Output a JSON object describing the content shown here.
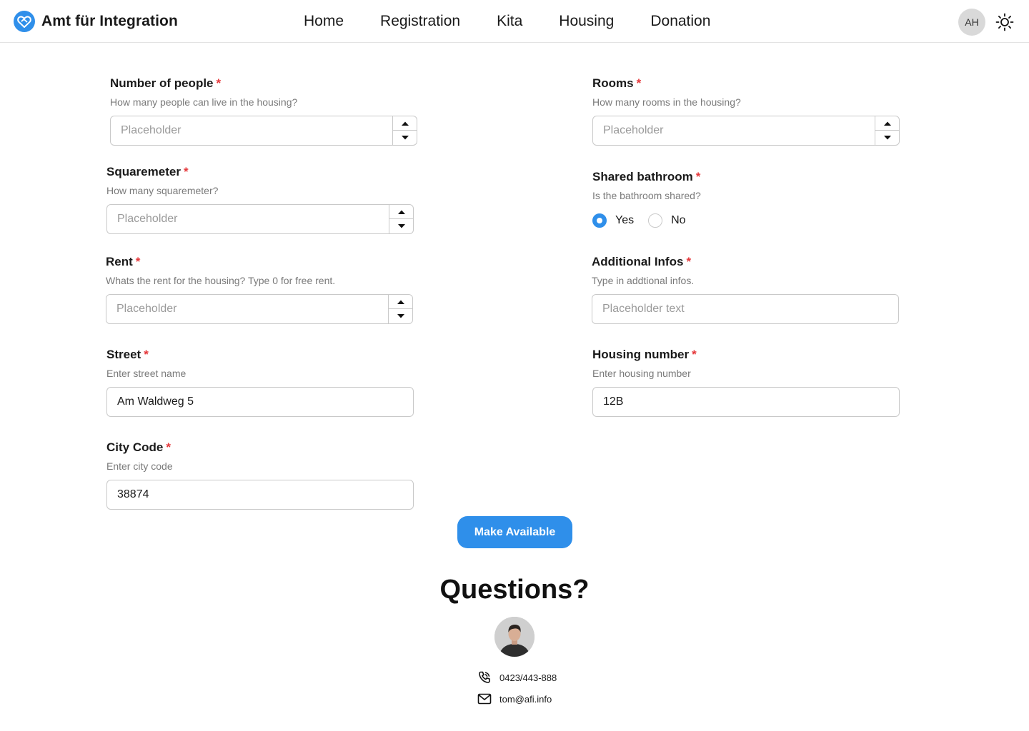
{
  "header": {
    "app_title": "Amt für Integration",
    "nav": [
      "Home",
      "Registration",
      "Kita",
      "Housing",
      "Donation"
    ],
    "user_initials": "AH",
    "accent_color": "#2f8fea"
  },
  "form": {
    "people": {
      "label": "Number of people",
      "required": "*",
      "help": "How many people can live in the housing?",
      "placeholder": "Placeholder"
    },
    "rooms": {
      "label": "Rooms",
      "required": "*",
      "help": "How many rooms in the housing?",
      "placeholder": "Placeholder"
    },
    "sqm": {
      "label": "Squaremeter",
      "required": "*",
      "help": "How many squaremeter?",
      "placeholder": "Placeholder"
    },
    "bathroom": {
      "label": "Shared bathroom",
      "required": "*",
      "help": "Is the bathroom shared?",
      "options": [
        "Yes",
        "No"
      ],
      "selected": "Yes"
    },
    "rent": {
      "label": "Rent",
      "required": "*",
      "help": "Whats the rent for the housing? Type 0 for free rent.",
      "placeholder": "Placeholder"
    },
    "infos": {
      "label": "Additional Infos",
      "required": "*",
      "help": "Type in addtional infos.",
      "placeholder": "Placeholder text"
    },
    "street": {
      "label": "Street",
      "required": "*",
      "help": "Enter street name",
      "value": "Am Waldweg 5"
    },
    "housing_number": {
      "label": "Housing number",
      "required": "*",
      "help": "Enter housing number",
      "value": "12B"
    },
    "city_code": {
      "label": "City Code",
      "required": "*",
      "help": "Enter city code",
      "value": "38874"
    },
    "submit_label": "Make Available"
  },
  "contact": {
    "heading": "Questions?",
    "phone": "0423/443-888",
    "email": "tom@afi.info"
  }
}
